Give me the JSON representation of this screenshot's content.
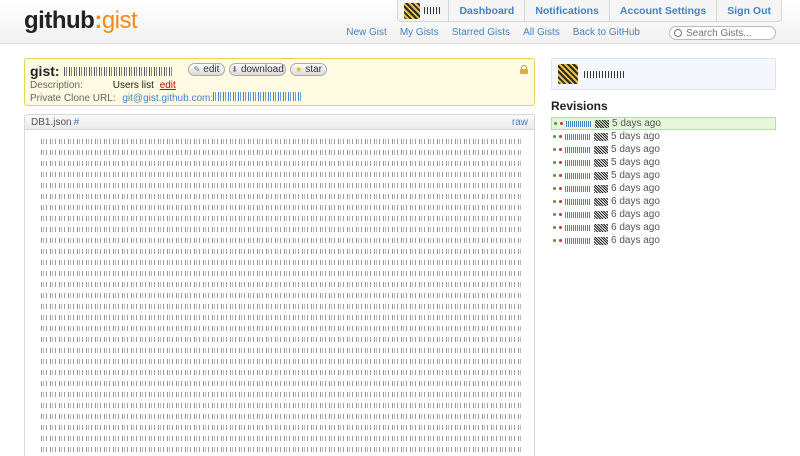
{
  "header": {
    "logo_main": "github",
    "logo_colon": ":",
    "logo_accent": "gist",
    "userbar_links": [
      "Dashboard",
      "Notifications",
      "Account Settings",
      "Sign Out"
    ],
    "subnav_links": [
      "New Gist",
      "My Gists",
      "Starred Gists",
      "All Gists",
      "Back to GitHub"
    ],
    "search_placeholder": "Search Gists..."
  },
  "gist": {
    "title_prefix": "gist:",
    "buttons": {
      "edit": "edit",
      "download": "download",
      "star": "star"
    },
    "description_label": "Description:",
    "description_value": "Users list",
    "description_edit": "edit",
    "clone_label": "Private Clone URL:",
    "clone_value": "git@gist.github.com:"
  },
  "file": {
    "name": "DB1.json",
    "anchor": "#",
    "raw_label": "raw"
  },
  "sidebar": {
    "revisions_heading": "Revisions",
    "revisions": [
      {
        "time": "5 days ago",
        "current": true
      },
      {
        "time": "5 days ago",
        "current": false
      },
      {
        "time": "5 days ago",
        "current": false
      },
      {
        "time": "5 days ago",
        "current": false
      },
      {
        "time": "5 days ago",
        "current": false
      },
      {
        "time": "6 days ago",
        "current": false
      },
      {
        "time": "6 days ago",
        "current": false
      },
      {
        "time": "6 days ago",
        "current": false
      },
      {
        "time": "6 days ago",
        "current": false
      },
      {
        "time": "6 days ago",
        "current": false
      }
    ]
  },
  "colors": {
    "accent": "#f28b13",
    "link": "#4183c4",
    "meta_bg": "#fffbe2",
    "current_rev_bg": "#e6f6d9"
  }
}
